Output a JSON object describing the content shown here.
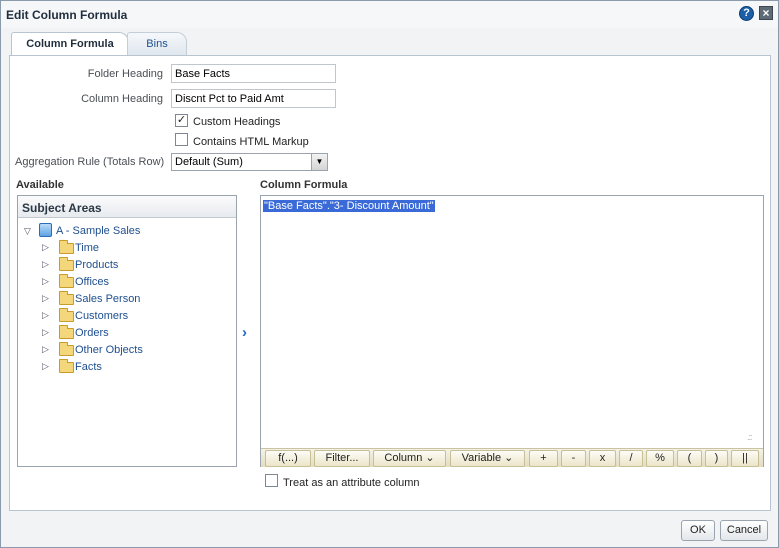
{
  "dialog": {
    "title": "Edit Column Formula"
  },
  "tabs": [
    {
      "label": "Column Formula"
    },
    {
      "label": "Bins"
    }
  ],
  "form": {
    "folder_heading_label": "Folder Heading",
    "folder_heading_value": "Base Facts",
    "column_heading_label": "Column Heading",
    "column_heading_value": "Discnt Pct to Paid Amt",
    "custom_headings_label": "Custom Headings",
    "custom_headings_checked": true,
    "contains_html_label": "Contains HTML Markup",
    "contains_html_checked": false,
    "aggregation_label": "Aggregation Rule (Totals Row)",
    "aggregation_value": "Default (Sum)"
  },
  "available": {
    "heading": "Available",
    "panel_title": "Subject Areas",
    "root": "A - Sample Sales",
    "folders": [
      "Time",
      "Products",
      "Offices",
      "Sales Person",
      "Customers",
      "Orders",
      "Other Objects",
      "Facts"
    ]
  },
  "formula": {
    "heading": "Column Formula",
    "text": "\"Base Facts\".\"3- Discount Amount\"",
    "buttons": [
      "f(...)",
      "Filter...",
      "Column ⌄",
      "Variable ⌄",
      "+",
      "-",
      "x",
      "/",
      "%",
      "(",
      ")",
      "||"
    ],
    "attribute_label": "Treat as an attribute column",
    "attribute_checked": false
  },
  "footer": {
    "ok": "OK",
    "cancel": "Cancel"
  }
}
